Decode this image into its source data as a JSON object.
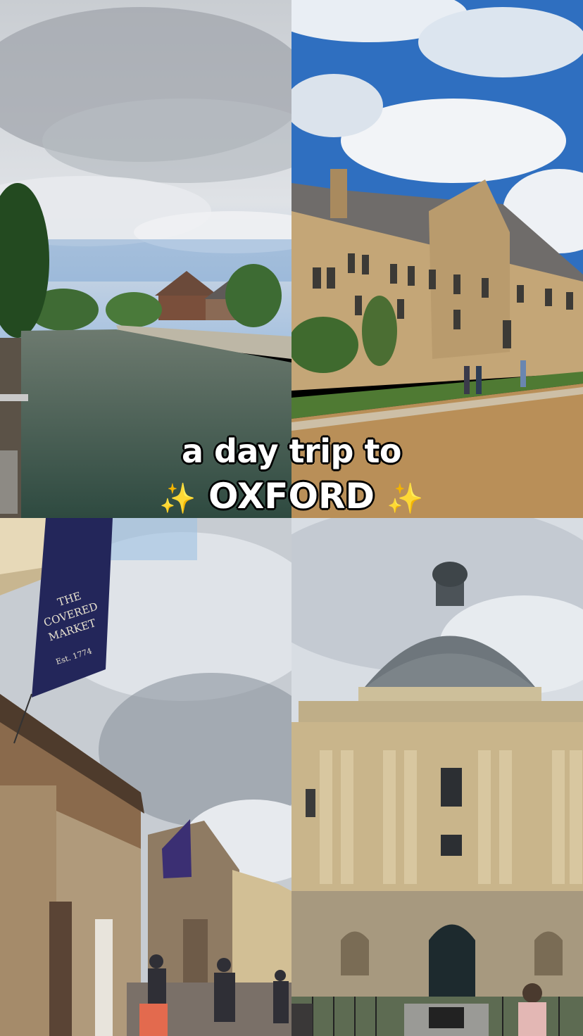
{
  "caption": {
    "line1": "a day trip to",
    "line2": "OXFORD",
    "sparkle": "✨"
  },
  "photos": {
    "market_banner": {
      "line1": "THE",
      "line2": "COVERED",
      "line3": "MARKET",
      "est": "Est. 1774"
    }
  }
}
